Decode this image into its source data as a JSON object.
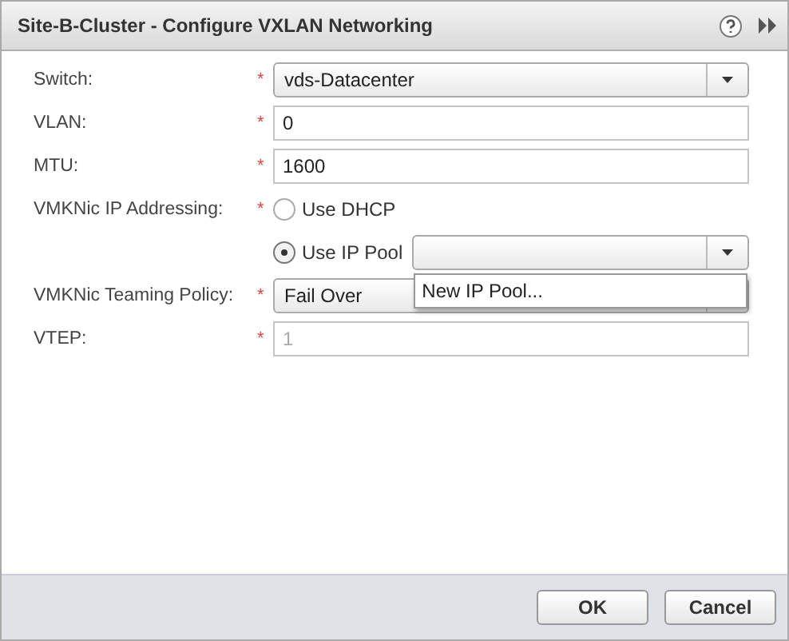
{
  "window": {
    "title": "Site-B-Cluster - Configure VXLAN Networking"
  },
  "fields": [
    {
      "label": "Switch:",
      "mark": "*",
      "kind": "select",
      "value": "vds-Datacenter",
      "disabled": false
    },
    {
      "label": "VLAN:",
      "mark": "*",
      "kind": "text",
      "value": "0",
      "disabled": false
    },
    {
      "label": "MTU:",
      "mark": "*",
      "kind": "text",
      "value": "1600",
      "disabled": false
    },
    {
      "label": "VMKNic IP Addressing:",
      "mark": "*",
      "kind": "radio",
      "options": [
        {
          "label": "Use DHCP",
          "selected": false
        },
        {
          "label": "Use IP Pool",
          "selected": true,
          "select": {
            "menu": [
              "New IP Pool..."
            ]
          }
        }
      ]
    },
    {
      "label": "VMKNic Teaming Policy:",
      "mark": "*",
      "kind": "select",
      "value": "Fail Over",
      "disabled": false
    },
    {
      "label": "VTEP:",
      "mark": "*",
      "kind": "text",
      "value": "1",
      "disabled": true
    }
  ],
  "buttons": [
    {
      "label": "OK"
    },
    {
      "label": "Cancel"
    }
  ]
}
